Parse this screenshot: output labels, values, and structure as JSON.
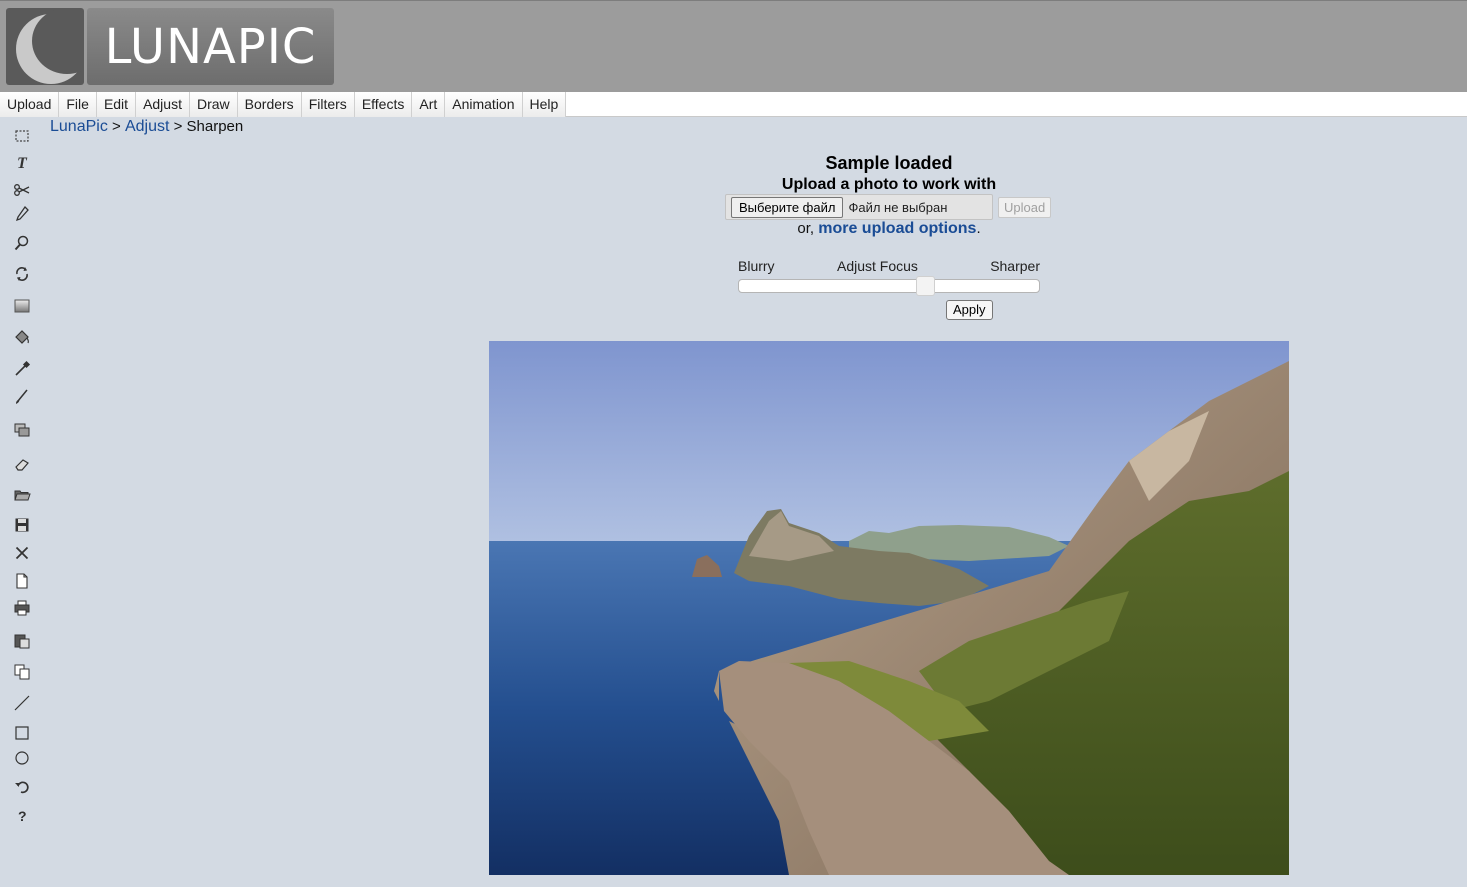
{
  "header": {
    "logo_text": "LUNAPIC"
  },
  "menu": [
    {
      "label": "Upload"
    },
    {
      "label": "File"
    },
    {
      "label": "Edit"
    },
    {
      "label": "Adjust"
    },
    {
      "label": "Draw"
    },
    {
      "label": "Borders"
    },
    {
      "label": "Filters"
    },
    {
      "label": "Effects"
    },
    {
      "label": "Art"
    },
    {
      "label": "Animation"
    },
    {
      "label": "Help"
    }
  ],
  "toolbar": [
    {
      "name": "select-icon"
    },
    {
      "name": "text-icon"
    },
    {
      "name": "scissors-icon"
    },
    {
      "name": "pencil-icon"
    },
    {
      "name": "zoom-icon"
    },
    {
      "name": "rotate-icon"
    },
    {
      "name": "gradient-icon"
    },
    {
      "name": "paint-bucket-icon"
    },
    {
      "name": "eyedropper-icon"
    },
    {
      "name": "brush-icon"
    },
    {
      "name": "layers-icon"
    },
    {
      "name": "eraser-icon"
    },
    {
      "name": "open-folder-icon"
    },
    {
      "name": "save-icon"
    },
    {
      "name": "close-icon"
    },
    {
      "name": "new-document-icon"
    },
    {
      "name": "print-icon"
    },
    {
      "name": "paste-icon"
    },
    {
      "name": "copy-icon"
    },
    {
      "name": "line-icon"
    },
    {
      "name": "rectangle-icon"
    },
    {
      "name": "circle-icon"
    },
    {
      "name": "undo-icon"
    },
    {
      "name": "help-icon"
    }
  ],
  "breadcrumb": {
    "home": "LunaPic",
    "sep1": " > ",
    "section": "Adjust",
    "sep2": " > ",
    "current": "Sharpen"
  },
  "panel": {
    "title": "Sample loaded",
    "subtitle": "Upload a photo to work with",
    "file_button": "Выберите файл",
    "file_status": "Файл не выбран",
    "upload_button": "Upload",
    "or_prefix": "or, ",
    "more_link": "more upload options",
    "or_suffix": "."
  },
  "slider": {
    "left_label": "Blurry",
    "center_label": "Adjust Focus",
    "right_label": "Sharper",
    "value_fraction": 0.63
  },
  "apply_button": "Apply",
  "colors": {
    "header_bg": "#9c9c9c",
    "page_bg": "#d3dae3",
    "link": "#1a4c95"
  }
}
